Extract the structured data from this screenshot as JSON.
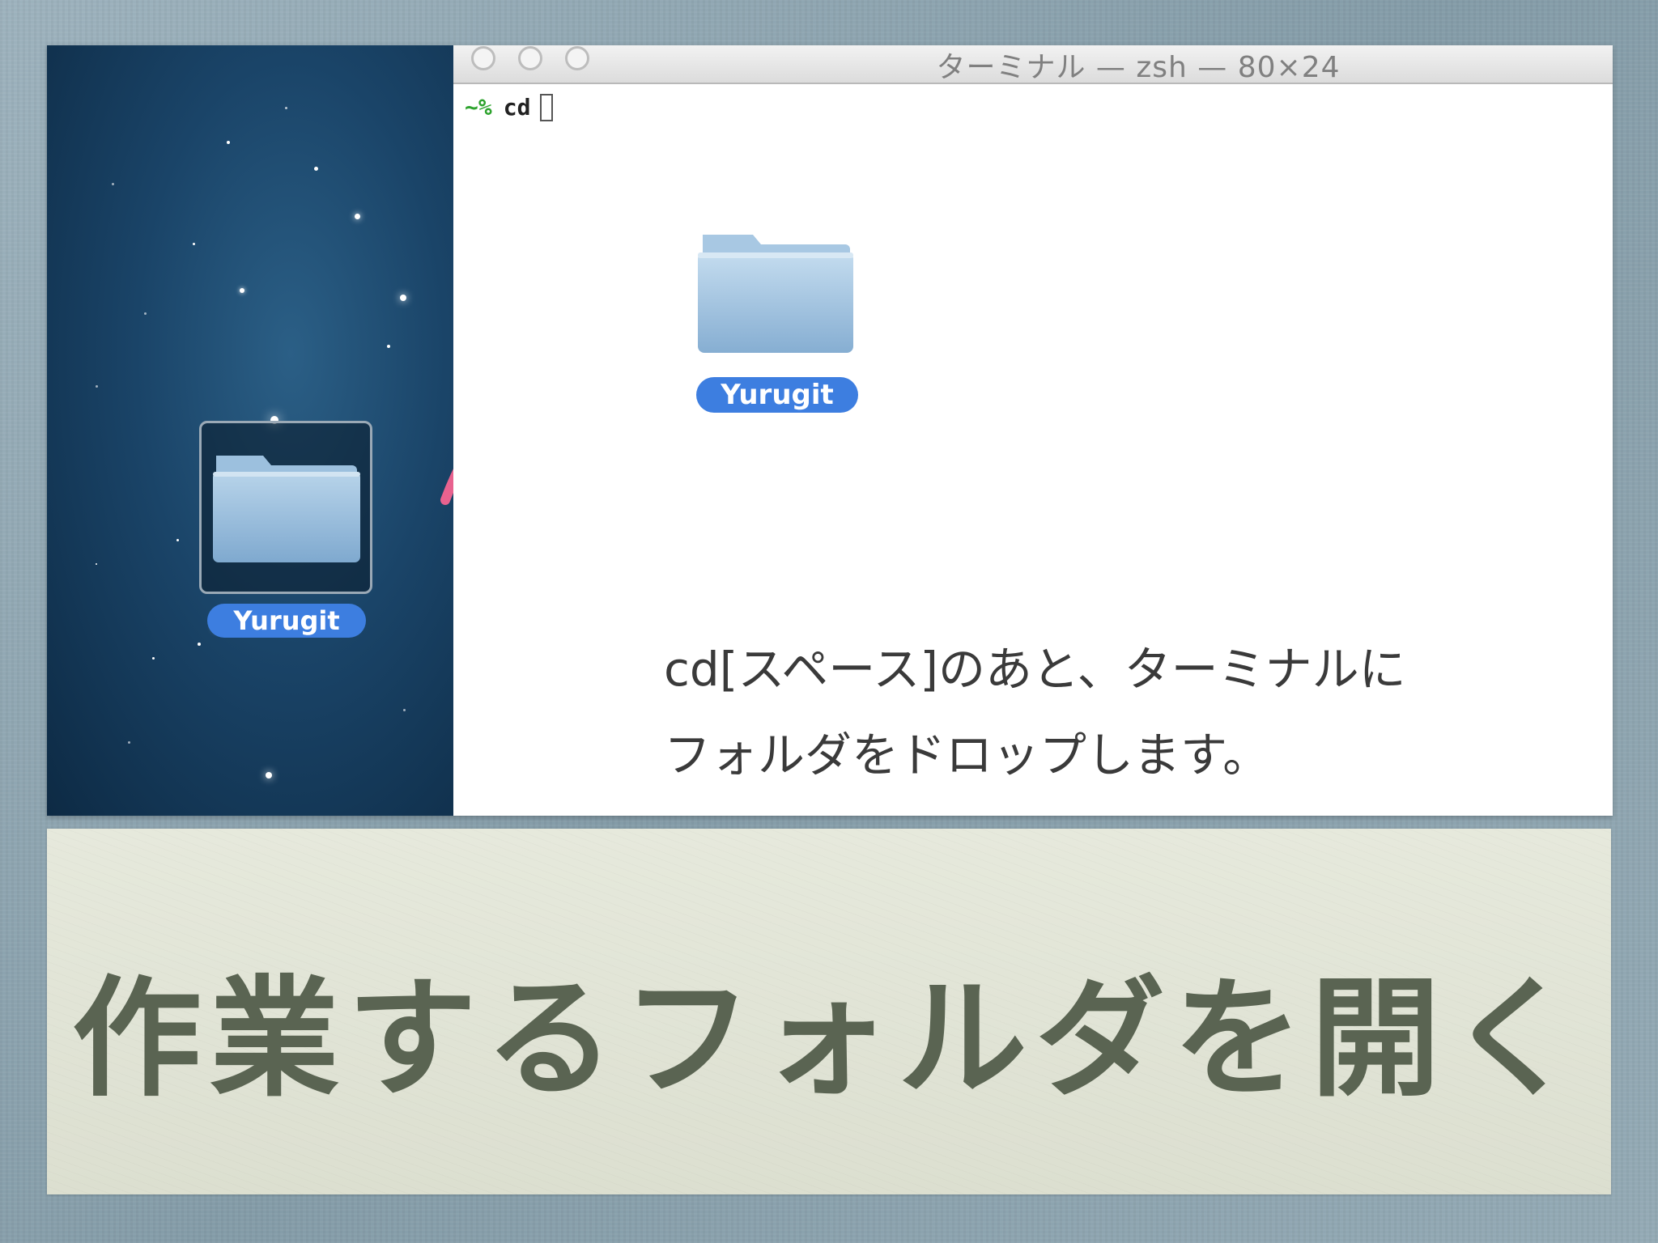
{
  "desktop": {
    "folder": {
      "name": "Yurugit",
      "selected": true
    }
  },
  "terminal": {
    "title": "ターミナル — zsh — 80×24",
    "prompt": "~%",
    "command": "cd",
    "dropped_folder": {
      "name": "Yurugit"
    },
    "instruction_line1": "cd[スペース]のあと、ターミナルに",
    "instruction_line2": "フォルダをドロップします。"
  },
  "slide": {
    "caption": "作業するフォルダを開く"
  },
  "colors": {
    "arrow": "#e8628f",
    "folder_label_bg": "#3d7ee0",
    "prompt": "#2ea32e",
    "caption_text": "#5a6452"
  }
}
